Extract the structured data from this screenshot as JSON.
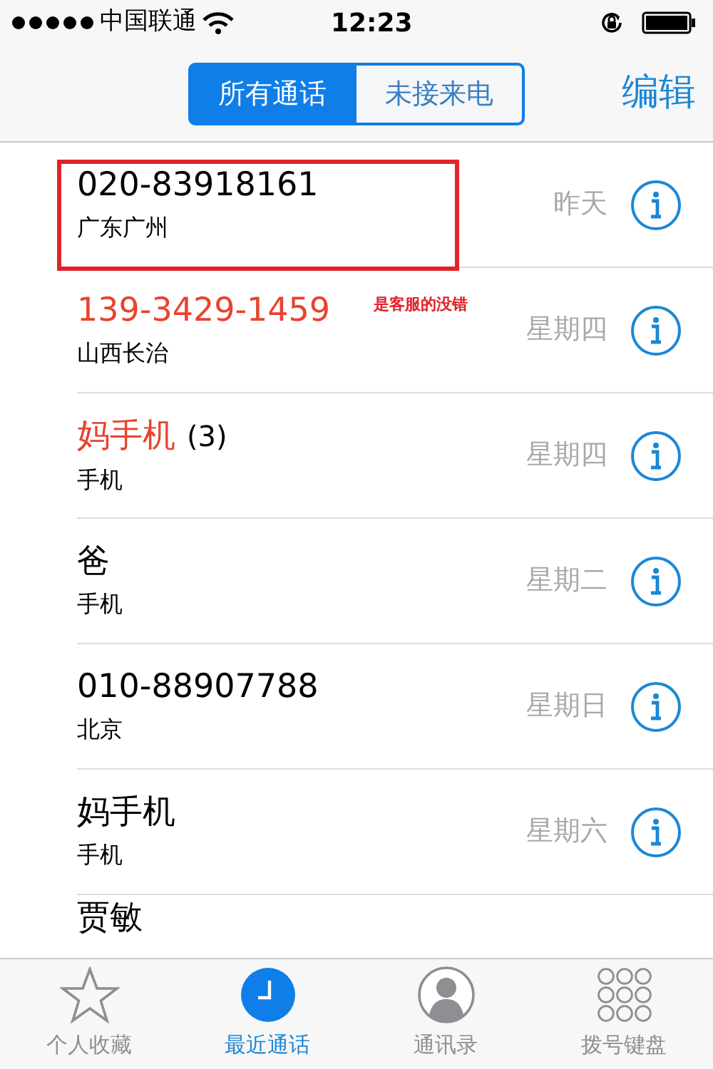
{
  "status_bar": {
    "carrier": "中国联通",
    "time": "12:23"
  },
  "segments": [
    {
      "label": "所有通话",
      "selected": true
    },
    {
      "label": "未接来电",
      "selected": false
    }
  ],
  "edit_button": "编辑",
  "calls": [
    {
      "name": "020-83918161",
      "detail": "广东广州",
      "date": "昨天",
      "missed": false,
      "highlighted": true
    },
    {
      "name": "139-3429-1459",
      "detail": "山西长治",
      "date": "星期四",
      "missed": true,
      "highlighted": false,
      "note": "是客服的没错"
    },
    {
      "name": "妈手机",
      "count": "(3)",
      "detail": "手机",
      "date": "星期四",
      "missed": true,
      "highlighted": false
    },
    {
      "name": "爸",
      "detail": "手机",
      "date": "星期二",
      "missed": false,
      "highlighted": false
    },
    {
      "name": "010-88907788",
      "detail": "北京",
      "date": "星期日",
      "missed": false,
      "highlighted": false
    },
    {
      "name": "妈手机",
      "detail": "手机",
      "date": "星期六",
      "missed": false,
      "highlighted": false
    },
    {
      "name": "贾敏",
      "missed": false,
      "highlighted": false
    }
  ],
  "tab_bar": [
    {
      "kind": "favorites",
      "label": "个人收藏",
      "selected": false
    },
    {
      "kind": "recents",
      "label": "最近通话",
      "selected": true
    },
    {
      "kind": "contacts",
      "label": "通讯录",
      "selected": false
    },
    {
      "kind": "keypad",
      "label": "拨号键盘",
      "selected": false
    }
  ]
}
